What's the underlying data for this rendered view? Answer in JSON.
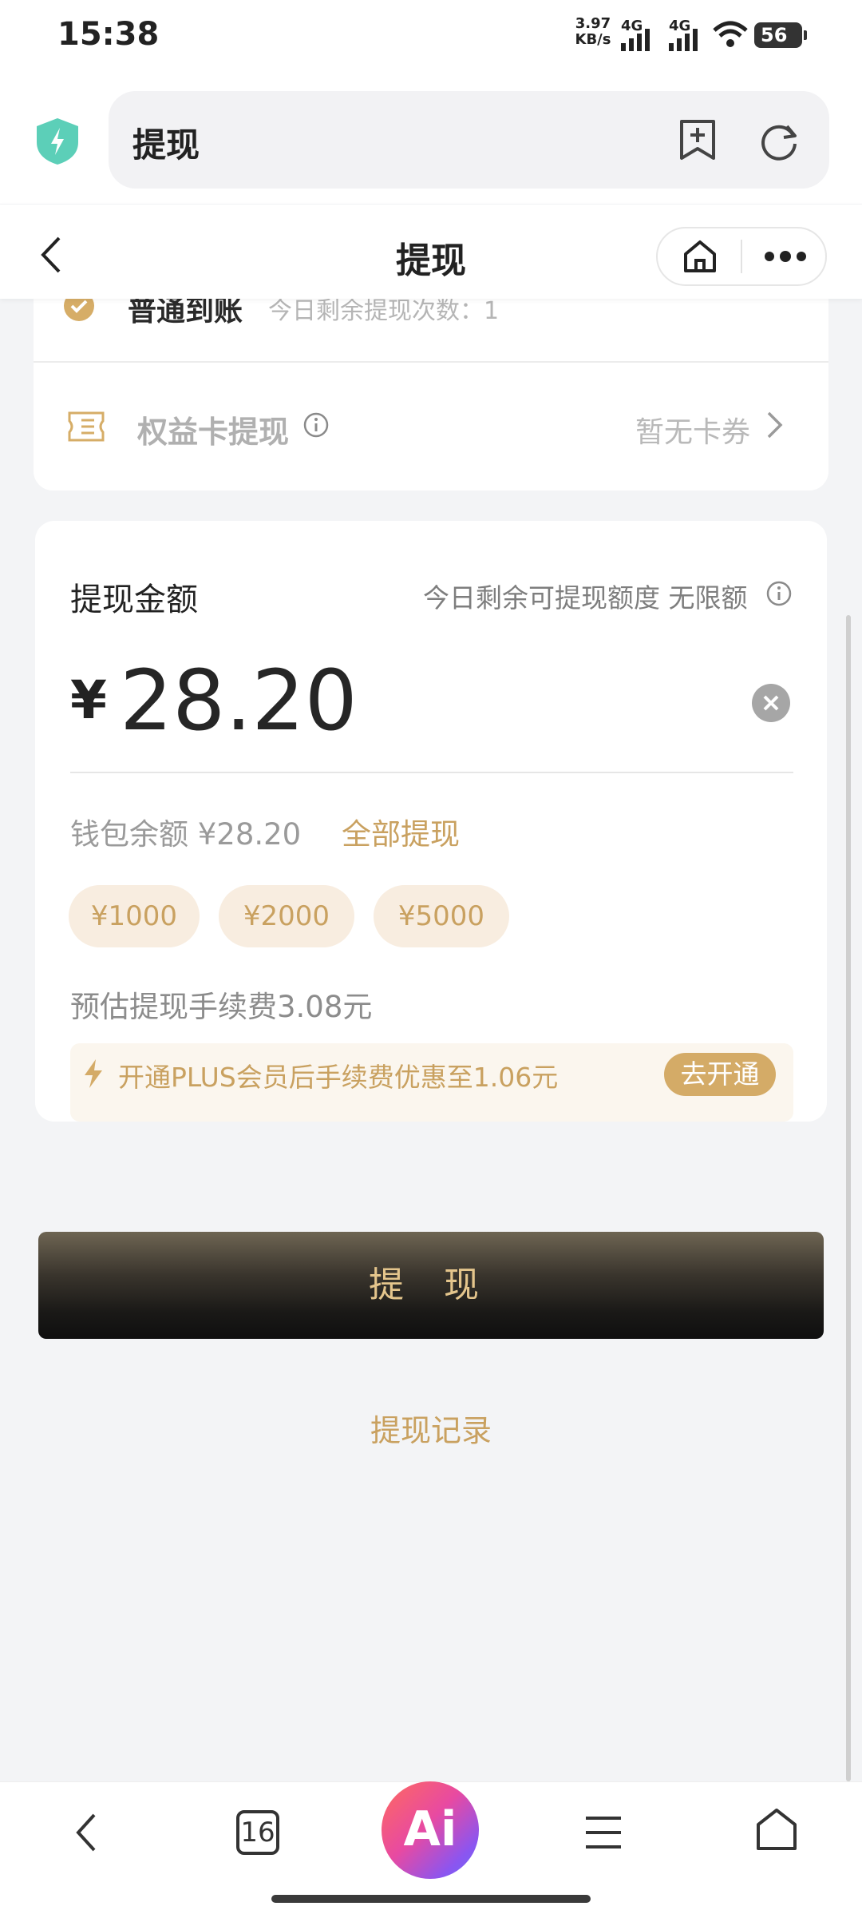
{
  "status_bar": {
    "time": "15:38",
    "net_speed_value": "3.97",
    "net_speed_unit": "KB/s",
    "signal1_label": "4G",
    "signal2_label": "4G",
    "battery": "56"
  },
  "browser": {
    "url_title": "提现"
  },
  "header": {
    "title": "提现"
  },
  "withdraw_methods": {
    "normal_label": "普通到账",
    "normal_note": "今日剩余提现次数：1",
    "rights_card_label": "权益卡提现",
    "rights_card_value": "暂无卡券"
  },
  "amount": {
    "label": "提现金额",
    "limit_text": "今日剩余可提现额度 无限额",
    "currency_symbol": "¥",
    "value": "28.20",
    "wallet_balance": "钱包余额 ¥28.20",
    "withdraw_all": "全部提现",
    "chips": [
      "¥1000",
      "¥2000",
      "¥5000"
    ],
    "fee_text": "预估提现手续费3.08元",
    "plus_text": "开通PLUS会员后手续费优惠至1.06元",
    "plus_button": "去开通"
  },
  "actions": {
    "withdraw_button": "提 现",
    "record_link": "提现记录"
  },
  "bottom_nav": {
    "tabs_count": "16",
    "ai_label": "Ai"
  },
  "colors": {
    "accent_gold": "#c9a160",
    "check_gold": "#d6ad67",
    "shield_teal": "#5ccfb8"
  }
}
